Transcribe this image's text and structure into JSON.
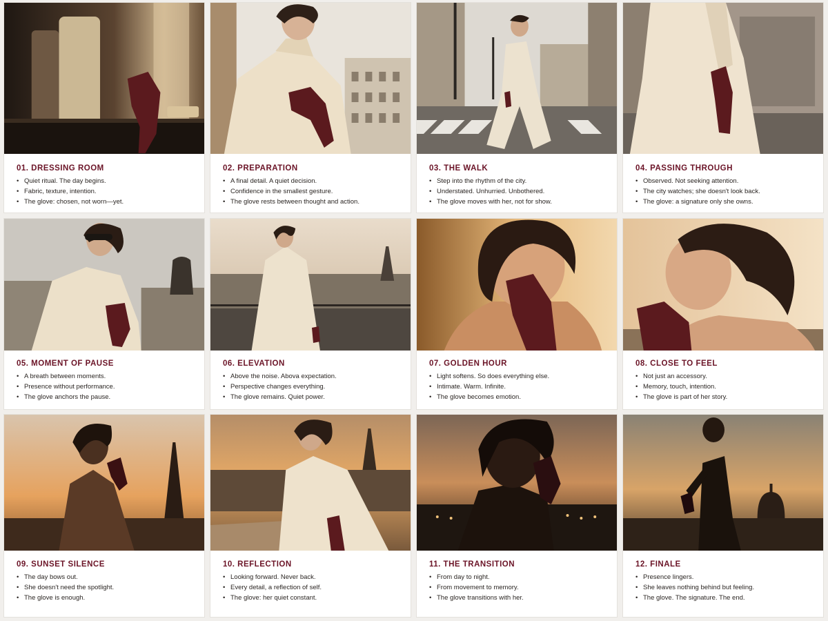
{
  "colors": {
    "accent": "#6b1427",
    "glove": "#5b1a1e",
    "cream": "#efe4d2",
    "background": "#f1efec"
  },
  "panels": [
    {
      "title": "01. DRESSING ROOM",
      "lines": [
        "Quiet ritual. The day begins.",
        "Fabric, texture, intention.",
        "The glove: chosen, not worn—yet."
      ]
    },
    {
      "title": "02. PREPARATION",
      "lines": [
        "A final detail. A quiet decision.",
        "Confidence in the smallest gesture.",
        "The glove rests between thought and action."
      ]
    },
    {
      "title": "03. THE WALK",
      "lines": [
        "Step into the rhythm of the city.",
        "Understated. Unhurried. Unbothered.",
        "The glove moves with her, not for show."
      ]
    },
    {
      "title": "04. PASSING THROUGH",
      "lines": [
        "Observed. Not seeking attention.",
        "The city watches; she doesn't look back.",
        "The glove: a signature only she owns."
      ]
    },
    {
      "title": "05. MOMENT OF PAUSE",
      "lines": [
        "A breath between moments.",
        "Presence without performance.",
        "The glove anchors the pause."
      ]
    },
    {
      "title": "06. ELEVATION",
      "lines": [
        "Above the noise. Abova expectation.",
        "Perspective changes everything.",
        "The glove remains. Quiet power."
      ]
    },
    {
      "title": "07. GOLDEN HOUR",
      "lines": [
        "Light softens. So does everything else.",
        "Intimate. Warm. Infinite.",
        "The glove becomes emotion."
      ]
    },
    {
      "title": "08. CLOSE TO FEEL",
      "lines": [
        "Not just an accessory.",
        "Memory, touch, intention.",
        "The glove is part of her story."
      ]
    },
    {
      "title": "09. SUNSET SILENCE",
      "lines": [
        "The day bows out.",
        "She doesn't need the spotlight.",
        "The glove is enough."
      ]
    },
    {
      "title": "10. REFLECTION",
      "lines": [
        "Looking forward. Never back.",
        "Every detail, a reflection of self.",
        "The glove: her quiet constant."
      ]
    },
    {
      "title": "11. THE TRANSITION",
      "lines": [
        "From day to night.",
        "From movement to memory.",
        "The glove transitions with her."
      ]
    },
    {
      "title": "12. FINALE",
      "lines": [
        "Presence lingers.",
        "She leaves nothing behind but feeling.",
        "The glove. The signature. The end."
      ]
    }
  ]
}
